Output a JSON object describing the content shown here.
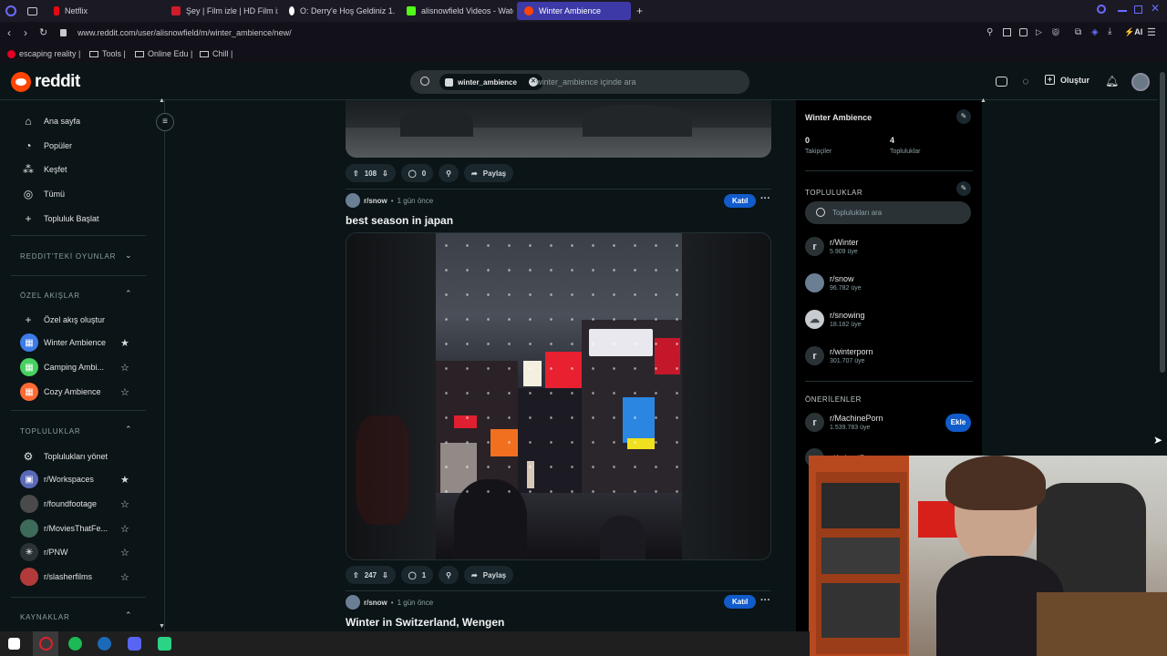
{
  "browser": {
    "tabs": [
      {
        "label": "Netflix",
        "color": "#e50914"
      },
      {
        "label": "Şey | Film izle | HD Film iz",
        "color": "#d11a2a"
      },
      {
        "label": "O: Derry'e Hoş Geldiniz 1.",
        "color": "#ffffff"
      },
      {
        "label": "alisnowfield Videos - Watc",
        "color": "#53fc18"
      },
      {
        "label": "Winter Ambience",
        "color": "#ff4500"
      }
    ],
    "url": "www.reddit.com/user/alisnowfield/m/winter_ambience/new/",
    "bookmarks": [
      "escaping reality |",
      "Tools |",
      "Online Edu |",
      "Chill |"
    ],
    "ai_label": "AI"
  },
  "header": {
    "logo_text": "reddit",
    "search_chip": "winter_ambience",
    "search_placeholder": "winter_ambience içinde ara",
    "create_label": "Oluştur"
  },
  "sidebar": {
    "nav": [
      {
        "label": "Ana sayfa",
        "icon": "home-icon"
      },
      {
        "label": "Popüler",
        "icon": "popular-icon"
      },
      {
        "label": "Keşfet",
        "icon": "explore-icon"
      },
      {
        "label": "Tümü",
        "icon": "all-icon"
      },
      {
        "label": "Topluluk Başlat",
        "icon": "plus-icon"
      }
    ],
    "games_header": "REDDIT'TEKİ OYUNLAR",
    "feeds_header": "ÖZEL AKIŞLAR",
    "create_feed": "Özel akış oluştur",
    "feeds": [
      {
        "label": "Winter Ambience",
        "color": "#3d7be8",
        "starred": true
      },
      {
        "label": "Camping Ambi...",
        "color": "#46d160",
        "starred": false
      },
      {
        "label": "Cozy Ambience",
        "color": "#ff6a33",
        "starred": false
      }
    ],
    "communities_header": "TOPLULUKLAR",
    "manage_label": "Toplulukları yönet",
    "communities": [
      {
        "label": "r/Workspaces",
        "color": "#5a6ab8",
        "starred": true
      },
      {
        "label": "r/foundfootage",
        "color": "#4a4a4a",
        "starred": false
      },
      {
        "label": "r/MoviesThatFe...",
        "color": "#3e6a5a",
        "starred": false
      },
      {
        "label": "r/PNW",
        "color": "#2a3236",
        "starred": false
      },
      {
        "label": "r/slasherfilms",
        "color": "#b23a3a",
        "starred": false
      }
    ],
    "resources_header": "KAYNAKLAR"
  },
  "feed": {
    "post0": {
      "votes": "108",
      "comments": "0",
      "share": "Paylaş"
    },
    "post1": {
      "sub": "r/snow",
      "time": "1 gün önce",
      "join": "Katıl",
      "title": "best season in japan",
      "votes": "247",
      "comments": "1",
      "share": "Paylaş"
    },
    "post2": {
      "sub": "r/snow",
      "time": "1 gün önce",
      "join": "Katıl",
      "title": "Winter in Switzerland, Wengen"
    }
  },
  "right": {
    "title": "Winter Ambience",
    "followers_value": "0",
    "followers_label": "Takipçiler",
    "communities_value": "4",
    "communities_label": "Topluluklar",
    "communities_header": "TOPLULUKLAR",
    "search_placeholder": "Toplulukları ara",
    "communities": [
      {
        "name": "r/Winter",
        "members": "5.909 üye"
      },
      {
        "name": "r/snow",
        "members": "96.782 üye"
      },
      {
        "name": "r/snowing",
        "members": "18.182 üye"
      },
      {
        "name": "r/winterporn",
        "members": "301.707 üye"
      }
    ],
    "suggested_header": "ÖNERİLENLER",
    "suggested": [
      {
        "name": "r/MachinePorn",
        "members": "1.539.783 üye",
        "action": "Ekle"
      },
      {
        "name": "r/AnimalPorn",
        "members": "",
        "action": ""
      }
    ]
  }
}
